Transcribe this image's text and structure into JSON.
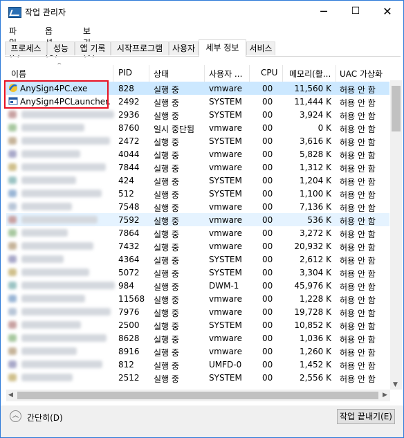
{
  "window": {
    "title": "작업 관리자",
    "controls": [
      "─",
      "☐",
      "✕"
    ]
  },
  "menu": [
    "파일(F)",
    "옵션(O)",
    "보기(V)"
  ],
  "tabs": [
    "프로세스",
    "성능",
    "앱 기록",
    "시작프로그램",
    "사용자",
    "세부 정보",
    "서비스"
  ],
  "active_tab": "세부 정보",
  "columns": {
    "name": "이름",
    "pid": "PID",
    "status": "상태",
    "user": "사용자 ...",
    "cpu": "CPU",
    "memory": "메모리(활...",
    "uac": "UAC 가상화"
  },
  "rows": [
    {
      "name": "AnySign4PC.exe",
      "pid": "828",
      "status": "실행 중",
      "user": "vmware",
      "cpu": "00",
      "mem": "11,560 K",
      "uac": "허용 안 함"
    },
    {
      "name": "AnySign4PCLauncher....",
      "pid": "2492",
      "status": "실행 중",
      "user": "SYSTEM",
      "cpu": "00",
      "mem": "11,444 K",
      "uac": "허용 안 함"
    },
    {
      "name": "",
      "pid": "2936",
      "status": "실행 중",
      "user": "SYSTEM",
      "cpu": "00",
      "mem": "3,924 K",
      "uac": "허용 안 함"
    },
    {
      "name": "",
      "pid": "8760",
      "status": "일시 중단됨",
      "user": "vmware",
      "cpu": "00",
      "mem": "0 K",
      "uac": "허용 안 함"
    },
    {
      "name": "",
      "pid": "2472",
      "status": "실행 중",
      "user": "SYSTEM",
      "cpu": "00",
      "mem": "3,616 K",
      "uac": "허용 안 함"
    },
    {
      "name": "",
      "pid": "4044",
      "status": "실행 중",
      "user": "vmware",
      "cpu": "00",
      "mem": "5,828 K",
      "uac": "허용 안 함"
    },
    {
      "name": "",
      "pid": "7844",
      "status": "실행 중",
      "user": "vmware",
      "cpu": "00",
      "mem": "1,312 K",
      "uac": "허용 안 함"
    },
    {
      "name": "",
      "pid": "424",
      "status": "실행 중",
      "user": "SYSTEM",
      "cpu": "00",
      "mem": "1,204 K",
      "uac": "허용 안 함"
    },
    {
      "name": "",
      "pid": "512",
      "status": "실행 중",
      "user": "SYSTEM",
      "cpu": "00",
      "mem": "1,100 K",
      "uac": "허용 안 함"
    },
    {
      "name": "",
      "pid": "7548",
      "status": "실행 중",
      "user": "vmware",
      "cpu": "00",
      "mem": "7,136 K",
      "uac": "허용 안 함"
    },
    {
      "name": "",
      "pid": "7592",
      "status": "실행 중",
      "user": "vmware",
      "cpu": "00",
      "mem": "536 K",
      "uac": "허용 안 함"
    },
    {
      "name": "",
      "pid": "7864",
      "status": "실행 중",
      "user": "vmware",
      "cpu": "00",
      "mem": "3,272 K",
      "uac": "허용 안 함"
    },
    {
      "name": "",
      "pid": "7432",
      "status": "실행 중",
      "user": "vmware",
      "cpu": "00",
      "mem": "20,932 K",
      "uac": "허용 안 함"
    },
    {
      "name": "",
      "pid": "4364",
      "status": "실행 중",
      "user": "SYSTEM",
      "cpu": "00",
      "mem": "2,612 K",
      "uac": "허용 안 함"
    },
    {
      "name": "",
      "pid": "5072",
      "status": "실행 중",
      "user": "SYSTEM",
      "cpu": "00",
      "mem": "3,304 K",
      "uac": "허용 안 함"
    },
    {
      "name": "",
      "pid": "984",
      "status": "실행 중",
      "user": "DWM-1",
      "cpu": "00",
      "mem": "45,976 K",
      "uac": "허용 안 함"
    },
    {
      "name": "",
      "pid": "11568",
      "status": "실행 중",
      "user": "vmware",
      "cpu": "00",
      "mem": "1,228 K",
      "uac": "허용 안 함"
    },
    {
      "name": "",
      "pid": "7976",
      "status": "실행 중",
      "user": "vmware",
      "cpu": "00",
      "mem": "19,728 K",
      "uac": "허용 안 함"
    },
    {
      "name": "",
      "pid": "2500",
      "status": "실행 중",
      "user": "SYSTEM",
      "cpu": "00",
      "mem": "10,852 K",
      "uac": "허용 안 함"
    },
    {
      "name": "",
      "pid": "8628",
      "status": "실행 중",
      "user": "vmware",
      "cpu": "00",
      "mem": "1,036 K",
      "uac": "허용 안 함"
    },
    {
      "name": "",
      "pid": "8916",
      "status": "실행 중",
      "user": "vmware",
      "cpu": "00",
      "mem": "1,260 K",
      "uac": "허용 안 함"
    },
    {
      "name": "",
      "pid": "812",
      "status": "실행 중",
      "user": "UMFD-0",
      "cpu": "00",
      "mem": "1,452 K",
      "uac": "허용 안 함"
    },
    {
      "name": "",
      "pid": "2512",
      "status": "실행 중",
      "user": "SYSTEM",
      "cpu": "00",
      "mem": "2,556 K",
      "uac": "허용 안 함"
    }
  ],
  "selected_row": 0,
  "hover_row": 10,
  "footer": {
    "collapse_label": "간단히(D)",
    "end_task_label": "작업 끝내기(E)"
  },
  "colors": {
    "selection": "#cce8ff",
    "hover": "#e5f3ff",
    "highlight_box": "#e81123",
    "window_border": "#2b79d8"
  }
}
